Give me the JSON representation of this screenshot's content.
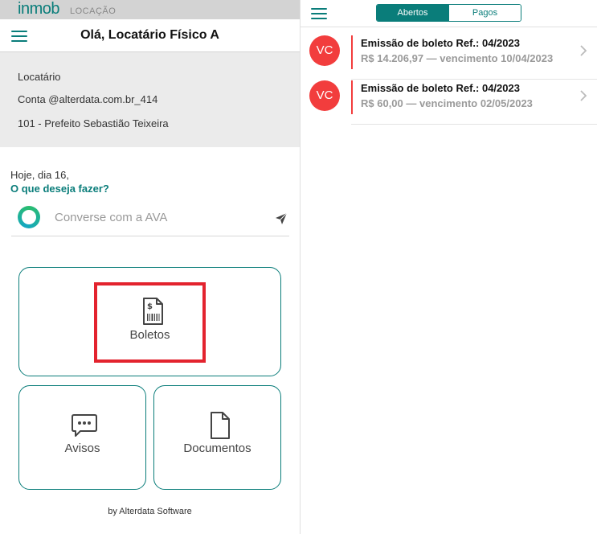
{
  "brand": {
    "logo": "inmob",
    "product": "LOCAÇÃO"
  },
  "header": {
    "greeting": "Olá, Locatário Físico A"
  },
  "account": {
    "role": "Locatário",
    "conta": "Conta @alterdata.com.br_414",
    "address": "101 - Prefeito Sebastião Teixeira"
  },
  "prompt": {
    "today": "Hoje, dia 16,",
    "question": "O que deseja fazer?"
  },
  "chat": {
    "placeholder": "Converse com a AVA"
  },
  "tiles": {
    "boletos": "Boletos",
    "avisos": "Avisos",
    "documentos": "Documentos"
  },
  "footer": {
    "text": "by Alterdata Software"
  },
  "tabs": {
    "open": "Abertos",
    "paid": "Pagos"
  },
  "bills": [
    {
      "initials": "VC",
      "title": "Emissão de boleto Ref.: 04/2023",
      "detail": "R$ 14.206,97 — vencimento 10/04/2023"
    },
    {
      "initials": "VC",
      "title": "Emissão de boleto Ref.: 04/2023",
      "detail": "R$ 60,00 — vencimento 02/05/2023"
    }
  ],
  "colors": {
    "accent": "#0a7d7a",
    "alert": "#f23d3d",
    "highlight": "#e3232e"
  },
  "icons": [
    "menu-icon",
    "ava-logo-icon",
    "send-icon",
    "boleto-icon",
    "chat-bubble-icon",
    "document-icon",
    "chevron-right-icon"
  ]
}
